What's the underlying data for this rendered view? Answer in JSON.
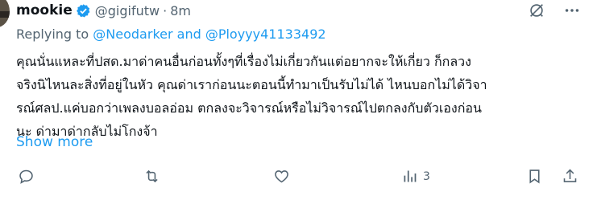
{
  "tweet": {
    "author_name": "mookie",
    "handle": "@gigifutw",
    "separator": "·",
    "time": "8m",
    "reply_prefix": "Replying to ",
    "reply_targets": "@Neodarker and @Ployyy41133492",
    "body_lines": [
      "คุณนั่นแหละที่ปสด.มาด่าคนอื่นก่อนทั้งๆที่เรื่องไม่เกี่ยวกันแต่อยากจะให้เกี่ยว ก็กลวง",
      "จริงนิไหนละสิ่งที่อยู่ในหัว คุณด่าเราก่อนนะตอนนี้ทำมาเป็นรับไม่ได้ ไหนบอกไม่ได้วิจา",
      "รณ์ศลป.แค่บอกว่าเพลงบอลอ่อม ตกลงจะวิจารณ์หรือไม่วิจารณ์ไปตกลงกับตัวเองก่อน",
      "นะ ด่ามาด่ากลับไม่โกงจ้า"
    ],
    "show_more": "Show more",
    "views_count": "3"
  },
  "icons": [
    "verified-badge-icon",
    "hide-icon",
    "more-icon",
    "reply-icon",
    "retweet-icon",
    "like-icon",
    "views-icon",
    "bookmark-icon",
    "share-icon"
  ],
  "colors": {
    "accent": "#1d9bf0",
    "muted": "#536471",
    "text": "#0f1419"
  }
}
